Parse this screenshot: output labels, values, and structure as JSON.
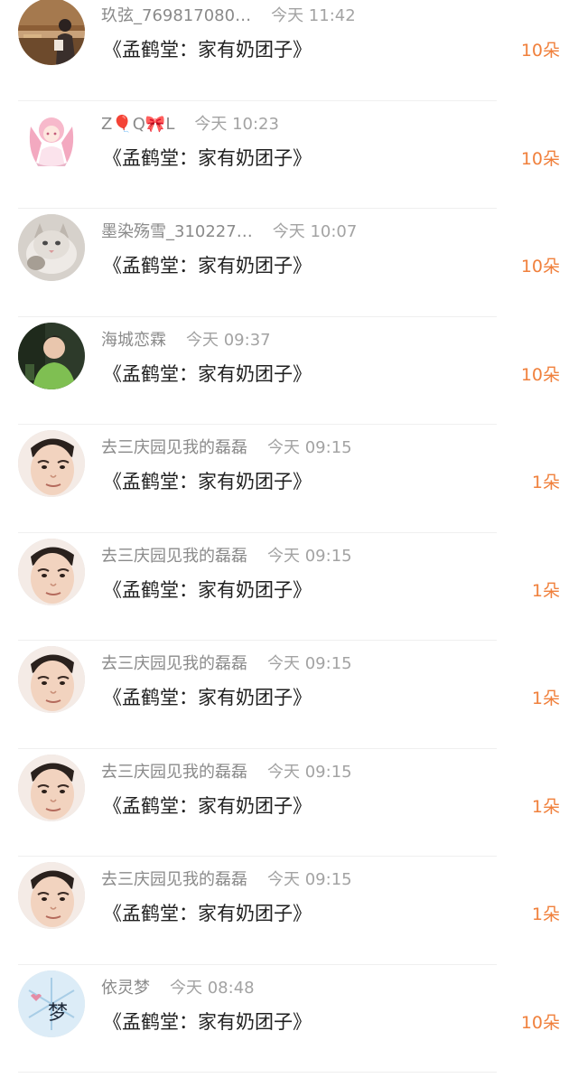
{
  "rows": [
    {
      "user_name": "玖弦_769817080…",
      "time": "今天 11:42",
      "title": "《孟鹤堂：家有奶团子》",
      "count": "10朵",
      "avatar_icon": "girl-bench-avatar-icon",
      "avatar_color": "#b8865a"
    },
    {
      "user_name": "Z🎈Q🎀L",
      "time": "今天 10:23",
      "title": "《孟鹤堂：家有奶团子》",
      "count": "10朵",
      "avatar_icon": "pink-anime-girl-avatar-icon",
      "avatar_color": "#f6c9d6"
    },
    {
      "user_name": "墨染殇雪_310227…",
      "time": "今天 10:07",
      "title": "《孟鹤堂：家有奶团子》",
      "count": "10朵",
      "avatar_icon": "cat-avatar-icon",
      "avatar_color": "#cfcac4"
    },
    {
      "user_name": "海城恋霖",
      "time": "今天 09:37",
      "title": "《孟鹤堂：家有奶团子》",
      "count": "10朵",
      "avatar_icon": "boy-green-shirt-avatar-icon",
      "avatar_color": "#5e8f4b"
    },
    {
      "user_name": "去三庆园见我的磊磊",
      "time": "今天 09:15",
      "title": "《孟鹤堂：家有奶团子》",
      "count": "1朵",
      "avatar_icon": "man-face-avatar-icon",
      "avatar_color": "#f1d2bd"
    },
    {
      "user_name": "去三庆园见我的磊磊",
      "time": "今天 09:15",
      "title": "《孟鹤堂：家有奶团子》",
      "count": "1朵",
      "avatar_icon": "man-face-avatar-icon",
      "avatar_color": "#f1d2bd"
    },
    {
      "user_name": "去三庆园见我的磊磊",
      "time": "今天 09:15",
      "title": "《孟鹤堂：家有奶团子》",
      "count": "1朵",
      "avatar_icon": "man-face-avatar-icon",
      "avatar_color": "#f1d2bd"
    },
    {
      "user_name": "去三庆园见我的磊磊",
      "time": "今天 09:15",
      "title": "《孟鹤堂：家有奶团子》",
      "count": "1朵",
      "avatar_icon": "man-face-avatar-icon",
      "avatar_color": "#f1d2bd"
    },
    {
      "user_name": "去三庆园见我的磊磊",
      "time": "今天 09:15",
      "title": "《孟鹤堂：家有奶团子》",
      "count": "1朵",
      "avatar_icon": "man-face-avatar-icon",
      "avatar_color": "#f1d2bd"
    },
    {
      "user_name": "依灵梦",
      "time": "今天 08:48",
      "title": "《孟鹤堂：家有奶团子》",
      "count": "10朵",
      "avatar_icon": "dream-snowflake-avatar-icon",
      "avatar_color": "#cfe6f5",
      "avatar_text": "梦"
    }
  ],
  "colors": {
    "count_orange": "#f0803c",
    "title_text": "#1f1f1f",
    "meta_text": "#8a8a8a"
  }
}
